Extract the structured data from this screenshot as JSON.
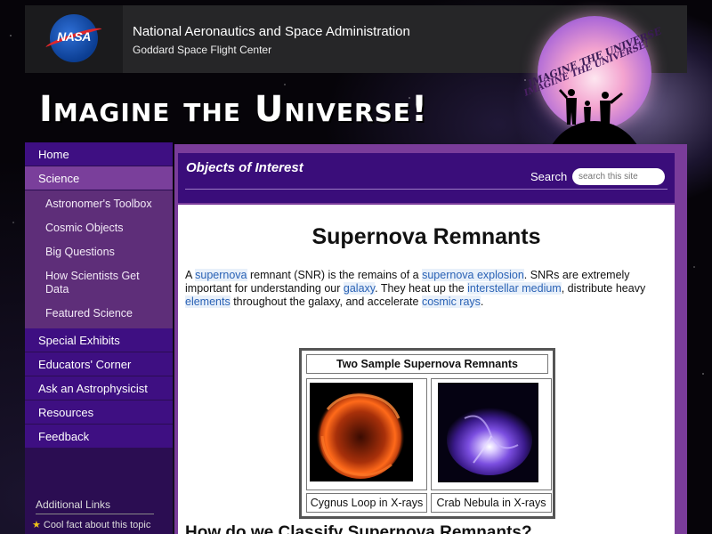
{
  "header": {
    "agency": "National Aeronautics and Space Administration",
    "center": "Goddard Space Flight Center",
    "logo_text": "NASA"
  },
  "site": {
    "title": "Imagine the Universe!",
    "emblem_line1": "IMAGINE THE UNIVERSE",
    "emblem_line2": "IMAGINE THE UNIVERSE!"
  },
  "sidebar": {
    "items": [
      {
        "label": "Home"
      },
      {
        "label": "Science"
      },
      {
        "label": "Astronomer's Toolbox"
      },
      {
        "label": "Cosmic Objects"
      },
      {
        "label": "Big Questions"
      },
      {
        "label": "How Scientists Get Data"
      },
      {
        "label": "Featured Science"
      },
      {
        "label": "Special Exhibits"
      },
      {
        "label": "Educators' Corner"
      },
      {
        "label": "Ask an Astrophysicist"
      },
      {
        "label": "Resources"
      },
      {
        "label": "Feedback"
      }
    ],
    "additional_links_heading": "Additional Links",
    "cool_fact": "Cool fact about this topic"
  },
  "section": {
    "label": "Objects of Interest",
    "search_label": "Search",
    "search_placeholder": "search this site"
  },
  "article": {
    "title": "Supernova Remnants",
    "intro": [
      {
        "text": "A "
      },
      {
        "link": "supernova"
      },
      {
        "text": " remnant (SNR) is the remains of a "
      },
      {
        "link": "supernova explosion"
      },
      {
        "text": ". SNRs are extremely important for understanding our "
      },
      {
        "link": "galaxy"
      },
      {
        "text": ". They heat up the "
      },
      {
        "link": "interstellar medium"
      },
      {
        "text": ", distribute heavy "
      },
      {
        "link": "elements"
      },
      {
        "text": " throughout the galaxy, and accelerate "
      },
      {
        "link": "cosmic rays"
      },
      {
        "text": "."
      }
    ],
    "sample_table": {
      "heading": "Two Sample Supernova Remnants",
      "captions": [
        "Cygnus Loop in X-rays",
        "Crab Nebula in X-rays"
      ]
    },
    "next_heading": "How do we Classify Supernova Remnants?"
  },
  "colors": {
    "nav_bg": "#3e0f82",
    "nav_active": "#7a3f9b",
    "sub_bg": "#5e2e79",
    "link": "#2a62b5"
  }
}
